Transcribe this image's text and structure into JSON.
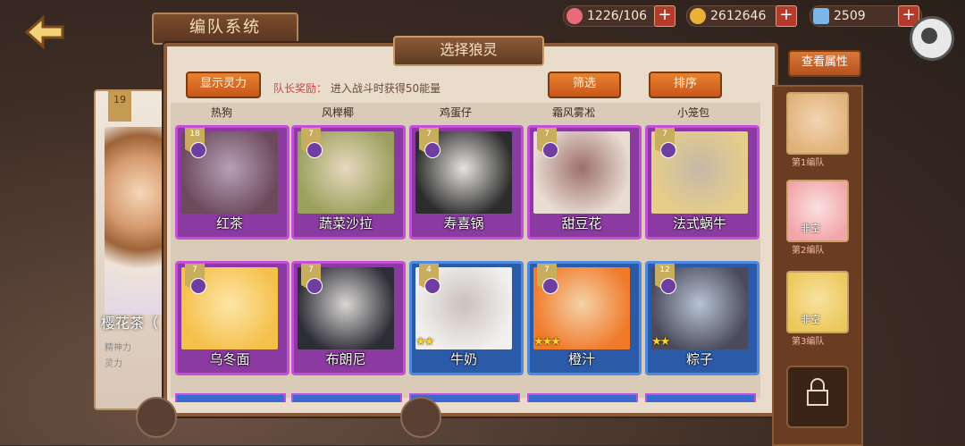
{
  "header": {
    "title": "编队系统",
    "hearts": "1226/106",
    "coins": "2612646",
    "gems": "2509",
    "plus": "+"
  },
  "left": {
    "level": "19",
    "name": "樱花茶（",
    "stat1": "精神力",
    "stat2": "灵力"
  },
  "modal": {
    "title": "选择狼灵",
    "show_power": "显示灵力",
    "reward_key": "队长奖励：",
    "reward_text": "进入战斗时获得50能量",
    "filter": "筛选",
    "sort": "排序"
  },
  "cut_names": [
    "热狗",
    "风榉椰",
    "鸡蛋仔",
    "霜风雾凇",
    "小笼包"
  ],
  "cards": [
    {
      "name": "红茶",
      "lvl": "18",
      "rarity": "purple",
      "colors": [
        "#6c4a5a",
        "#b7a0b8"
      ],
      "stars": 0
    },
    {
      "name": "蔬菜沙拉",
      "lvl": "7",
      "rarity": "purple",
      "colors": [
        "#9aa15d",
        "#e8d8bf"
      ],
      "stars": 0
    },
    {
      "name": "寿喜锅",
      "lvl": "7",
      "rarity": "purple",
      "colors": [
        "#2c2c2c",
        "#e6e4e0"
      ],
      "stars": 0
    },
    {
      "name": "甜豆花",
      "lvl": "7",
      "rarity": "purple",
      "colors": [
        "#e9ddd3",
        "#9d6f6b"
      ],
      "stars": 0
    },
    {
      "name": "法式蜗牛",
      "lvl": "7",
      "rarity": "purple",
      "colors": [
        "#e7cd8a",
        "#c5b9a8"
      ],
      "stars": 0
    },
    {
      "name": "乌冬面",
      "lvl": "7",
      "rarity": "purple",
      "colors": [
        "#f5c04a",
        "#fde6a8"
      ],
      "stars": 0
    },
    {
      "name": "布朗尼",
      "lvl": "7",
      "rarity": "purple",
      "colors": [
        "#2d2d35",
        "#dad7d4"
      ],
      "stars": 0
    },
    {
      "name": "牛奶",
      "lvl": "4",
      "rarity": "blue",
      "colors": [
        "#f2f0ee",
        "#c9c2bd"
      ],
      "stars": 2
    },
    {
      "name": "橙汁",
      "lvl": "7",
      "rarity": "blue",
      "colors": [
        "#f07a2a",
        "#f5d2a8"
      ],
      "stars": 3
    },
    {
      "name": "粽子",
      "lvl": "12",
      "rarity": "blue",
      "colors": [
        "#4a4a5a",
        "#b7c4d4"
      ],
      "stars": 2
    }
  ],
  "sidebar": {
    "view_attr": "查看属性",
    "teams": [
      {
        "label": "第1编队",
        "colors": [
          "#e1b178",
          "#f3d4b4"
        ],
        "flag": ""
      },
      {
        "label": "第2编队",
        "colors": [
          "#f2a4a8",
          "#fbe0e0"
        ],
        "flag": "非空"
      },
      {
        "label": "第3编队",
        "colors": [
          "#ecc85a",
          "#f7e2a0"
        ],
        "flag": "非空"
      }
    ]
  }
}
